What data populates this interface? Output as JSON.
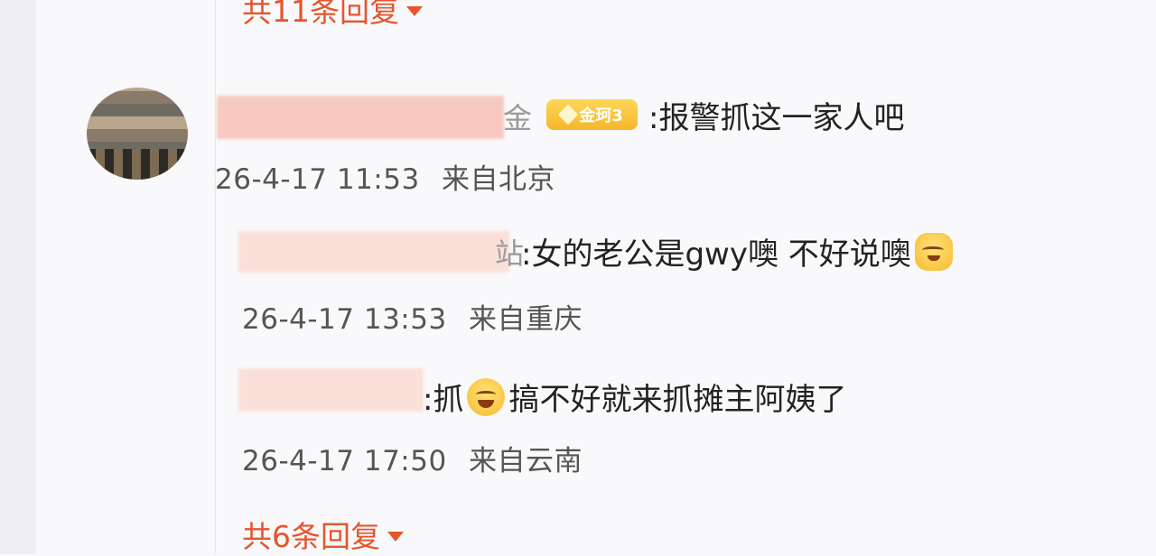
{
  "reply_toggles": {
    "top": "共11条回复",
    "bottom": "共6条回复"
  },
  "main_comment": {
    "name_tail": "金",
    "badge": "金珂3",
    "text": ":报警抓这一家人吧",
    "time": "26-4-17 11:53",
    "location": "来自北京"
  },
  "replies": [
    {
      "name_tail": "站",
      "text_before": ":女的老公是gwy噢 不好说噢",
      "emoji": "doge-cat-emoji",
      "time": "26-4-17 13:53",
      "location": "来自重庆"
    },
    {
      "text_before": ":抓",
      "emoji": "laugh-cry-emoji",
      "text_after": "搞不好就来抓摊主阿姨了",
      "time": "26-4-17 17:50",
      "location": "来自云南"
    }
  ],
  "colors": {
    "accent": "#e6552d",
    "badge": "#f4b72a"
  }
}
